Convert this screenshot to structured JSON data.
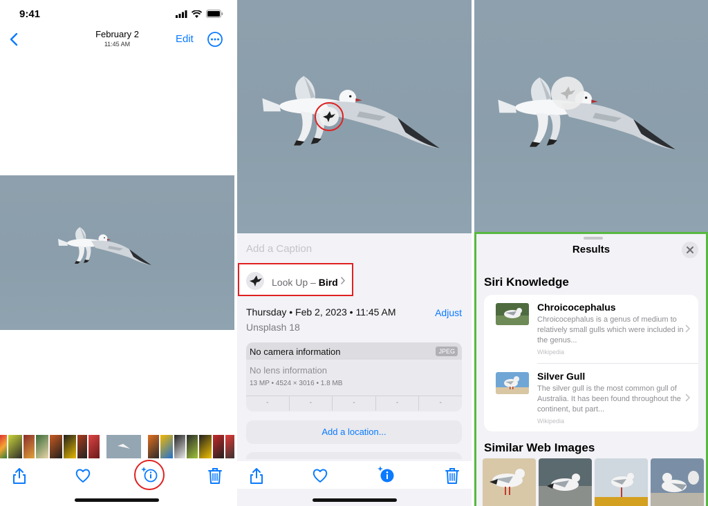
{
  "status": {
    "time": "9:41"
  },
  "viewer": {
    "title": "February 2",
    "subtitle": "11:45 AM",
    "edit_label": "Edit"
  },
  "info": {
    "caption_placeholder": "Add a Caption",
    "lookup_prefix": "Look Up – ",
    "lookup_subject": "Bird",
    "date": "Thursday • Feb 2, 2023 • 11:45 AM",
    "adjust_label": "Adjust",
    "source": "Unsplash 18",
    "camera": "No camera information",
    "format_badge": "JPEG",
    "lens": "No lens information",
    "specs": "13 MP  •  4524 × 3016  •  1.8 MB",
    "exif_placeholders": [
      "-",
      "-",
      "-",
      "-",
      "-"
    ],
    "location_label": "Add a location..."
  },
  "results": {
    "title": "Results",
    "siri_heading": "Siri Knowledge",
    "items": [
      {
        "title": "Chroicocephalus",
        "desc": "Chroicocephalus is a genus of medium to relatively small gulls which were included in the genus...",
        "source": "Wikipedia"
      },
      {
        "title": "Silver Gull",
        "desc": "The silver gull is the most common gull of Australia. It has been found throughout the continent, but part...",
        "source": "Wikipedia"
      }
    ],
    "web_heading": "Similar Web Images"
  },
  "colors": {
    "accent": "#0a7aff",
    "highlight_red": "#e02020",
    "highlight_green": "#58b840",
    "sky": "#8ea0ad"
  },
  "icons": {
    "back": "chevron-left-icon",
    "more": "ellipsis-circle-icon",
    "share": "share-icon",
    "favorite": "heart-icon",
    "info": "info-sparkle-icon",
    "delete": "trash-icon",
    "lookup": "bird-icon",
    "close": "close-icon"
  }
}
